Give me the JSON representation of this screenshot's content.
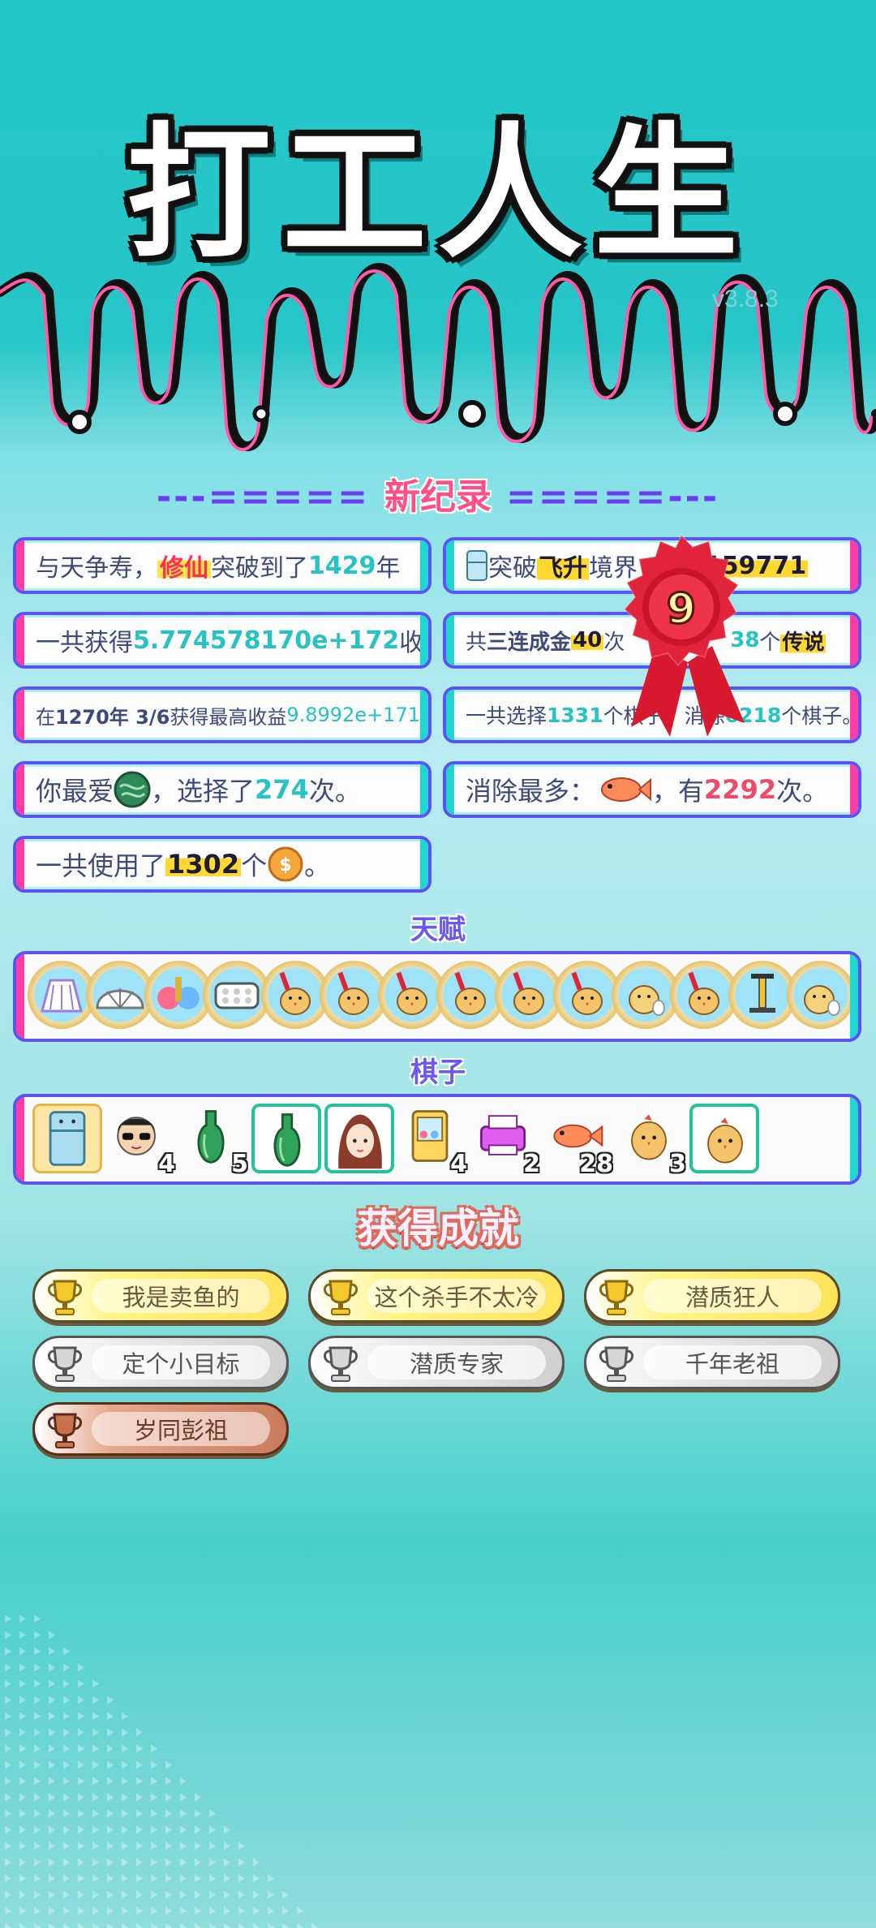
{
  "header": {
    "title": "打工人生",
    "version": "v3.8.3"
  },
  "new_record": {
    "dashes_left": "---=====",
    "label": "新纪录",
    "dashes_right": "=====---"
  },
  "records": {
    "r1": {
      "a": "与天争寿，",
      "b": "修仙",
      "c": "突破到了",
      "d": "1429",
      "e": "年"
    },
    "r2": {
      "a": "突破",
      "b": "飞升",
      "c": "境界",
      "d": "2159771"
    },
    "r3": {
      "a": "一共获得",
      "b": "5.774578170e+172",
      "c": "收益"
    },
    "r4": {
      "a": "共",
      "b": "三连成金",
      "c": "40",
      "d": "次",
      "e": "38",
      "f": "个",
      "g": "传说"
    },
    "r5": {
      "a": "在 ",
      "b": "1270年 3/6",
      "c": " 获得最高收益",
      "d": "9.8992e+171"
    },
    "r6": {
      "a": "一共选择",
      "b": "1331",
      "c": "个棋子，",
      "d": "消除",
      "e": "6218",
      "f": "个棋子。"
    },
    "r7": {
      "a": "你最爱",
      "b": "，选择了",
      "c": "274",
      "d": "次。"
    },
    "r8": {
      "a": "消除最多：",
      "b": "，有",
      "c": "2292",
      "d": "次。"
    },
    "r9": {
      "a": "一共使用了",
      "b": "1302",
      "c": "个",
      "d": "。"
    }
  },
  "seal": {
    "number": "9"
  },
  "talent": {
    "label": "天赋",
    "items": [
      "skirt-icon",
      "shell-icon",
      "thermos-icon",
      "pill-pack-icon",
      "chick-syringe-icon",
      "chick-syringe-icon",
      "chick-syringe-icon",
      "chick-syringe-icon",
      "chick-syringe-icon",
      "chick-syringe-icon",
      "chick-egg-icon",
      "chick-syringe-icon",
      "pump-icon",
      "chick-egg-icon"
    ]
  },
  "pieces": {
    "label": "棋子",
    "items": [
      {
        "icon": "fridge-icon",
        "count": ""
      },
      {
        "icon": "man-sunglasses-icon",
        "count": "4"
      },
      {
        "icon": "green-bottle-icon",
        "count": "5"
      },
      {
        "icon": "green-bottle-icon",
        "count": ""
      },
      {
        "icon": "woman-avatar-icon",
        "count": ""
      },
      {
        "icon": "claw-machine-icon",
        "count": "4"
      },
      {
        "icon": "printer-icon",
        "count": "2"
      },
      {
        "icon": "fish-icon",
        "count": "28"
      },
      {
        "icon": "chick-icon",
        "count": "3"
      },
      {
        "icon": "chick-icon",
        "count": ""
      }
    ]
  },
  "achievements": {
    "title": "获得成就",
    "items": [
      {
        "label": "我是卖鱼的",
        "tier": "gold"
      },
      {
        "label": "这个杀手不太冷",
        "tier": "gold"
      },
      {
        "label": "潜质狂人",
        "tier": "gold"
      },
      {
        "label": "定个小目标",
        "tier": "silver"
      },
      {
        "label": "潜质专家",
        "tier": "silver"
      },
      {
        "label": "千年老祖",
        "tier": "silver"
      },
      {
        "label": "岁同彭祖",
        "tier": "bronze"
      }
    ]
  },
  "colors": {
    "teal": "#25c3c3",
    "pink": "#ff3ba6",
    "purple": "#5c54f2",
    "red": "#f04a6a"
  }
}
